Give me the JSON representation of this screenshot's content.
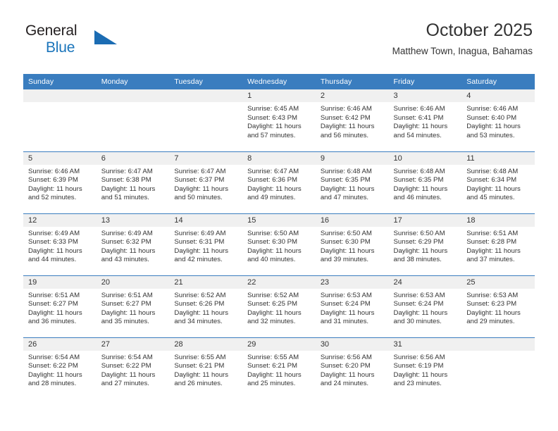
{
  "brand": {
    "name_part1": "General",
    "name_part2": "Blue",
    "accent_color": "#1b6cb3"
  },
  "header": {
    "title": "October 2025",
    "subtitle": "Matthew Town, Inagua, Bahamas"
  },
  "calendar": {
    "header_bg": "#3a7dbf",
    "daynum_bg": "#f0f0f0",
    "columns": [
      "Sunday",
      "Monday",
      "Tuesday",
      "Wednesday",
      "Thursday",
      "Friday",
      "Saturday"
    ],
    "weeks": [
      [
        {
          "day": "",
          "sunrise": "",
          "sunset": "",
          "daylight": "",
          "blank": true
        },
        {
          "day": "",
          "sunrise": "",
          "sunset": "",
          "daylight": "",
          "blank": true
        },
        {
          "day": "",
          "sunrise": "",
          "sunset": "",
          "daylight": "",
          "blank": true
        },
        {
          "day": "1",
          "sunrise": "Sunrise: 6:45 AM",
          "sunset": "Sunset: 6:43 PM",
          "daylight": "Daylight: 11 hours and 57 minutes."
        },
        {
          "day": "2",
          "sunrise": "Sunrise: 6:46 AM",
          "sunset": "Sunset: 6:42 PM",
          "daylight": "Daylight: 11 hours and 56 minutes."
        },
        {
          "day": "3",
          "sunrise": "Sunrise: 6:46 AM",
          "sunset": "Sunset: 6:41 PM",
          "daylight": "Daylight: 11 hours and 54 minutes."
        },
        {
          "day": "4",
          "sunrise": "Sunrise: 6:46 AM",
          "sunset": "Sunset: 6:40 PM",
          "daylight": "Daylight: 11 hours and 53 minutes."
        }
      ],
      [
        {
          "day": "5",
          "sunrise": "Sunrise: 6:46 AM",
          "sunset": "Sunset: 6:39 PM",
          "daylight": "Daylight: 11 hours and 52 minutes."
        },
        {
          "day": "6",
          "sunrise": "Sunrise: 6:47 AM",
          "sunset": "Sunset: 6:38 PM",
          "daylight": "Daylight: 11 hours and 51 minutes."
        },
        {
          "day": "7",
          "sunrise": "Sunrise: 6:47 AM",
          "sunset": "Sunset: 6:37 PM",
          "daylight": "Daylight: 11 hours and 50 minutes."
        },
        {
          "day": "8",
          "sunrise": "Sunrise: 6:47 AM",
          "sunset": "Sunset: 6:36 PM",
          "daylight": "Daylight: 11 hours and 49 minutes."
        },
        {
          "day": "9",
          "sunrise": "Sunrise: 6:48 AM",
          "sunset": "Sunset: 6:35 PM",
          "daylight": "Daylight: 11 hours and 47 minutes."
        },
        {
          "day": "10",
          "sunrise": "Sunrise: 6:48 AM",
          "sunset": "Sunset: 6:35 PM",
          "daylight": "Daylight: 11 hours and 46 minutes."
        },
        {
          "day": "11",
          "sunrise": "Sunrise: 6:48 AM",
          "sunset": "Sunset: 6:34 PM",
          "daylight": "Daylight: 11 hours and 45 minutes."
        }
      ],
      [
        {
          "day": "12",
          "sunrise": "Sunrise: 6:49 AM",
          "sunset": "Sunset: 6:33 PM",
          "daylight": "Daylight: 11 hours and 44 minutes."
        },
        {
          "day": "13",
          "sunrise": "Sunrise: 6:49 AM",
          "sunset": "Sunset: 6:32 PM",
          "daylight": "Daylight: 11 hours and 43 minutes."
        },
        {
          "day": "14",
          "sunrise": "Sunrise: 6:49 AM",
          "sunset": "Sunset: 6:31 PM",
          "daylight": "Daylight: 11 hours and 42 minutes."
        },
        {
          "day": "15",
          "sunrise": "Sunrise: 6:50 AM",
          "sunset": "Sunset: 6:30 PM",
          "daylight": "Daylight: 11 hours and 40 minutes."
        },
        {
          "day": "16",
          "sunrise": "Sunrise: 6:50 AM",
          "sunset": "Sunset: 6:30 PM",
          "daylight": "Daylight: 11 hours and 39 minutes."
        },
        {
          "day": "17",
          "sunrise": "Sunrise: 6:50 AM",
          "sunset": "Sunset: 6:29 PM",
          "daylight": "Daylight: 11 hours and 38 minutes."
        },
        {
          "day": "18",
          "sunrise": "Sunrise: 6:51 AM",
          "sunset": "Sunset: 6:28 PM",
          "daylight": "Daylight: 11 hours and 37 minutes."
        }
      ],
      [
        {
          "day": "19",
          "sunrise": "Sunrise: 6:51 AM",
          "sunset": "Sunset: 6:27 PM",
          "daylight": "Daylight: 11 hours and 36 minutes."
        },
        {
          "day": "20",
          "sunrise": "Sunrise: 6:51 AM",
          "sunset": "Sunset: 6:27 PM",
          "daylight": "Daylight: 11 hours and 35 minutes."
        },
        {
          "day": "21",
          "sunrise": "Sunrise: 6:52 AM",
          "sunset": "Sunset: 6:26 PM",
          "daylight": "Daylight: 11 hours and 34 minutes."
        },
        {
          "day": "22",
          "sunrise": "Sunrise: 6:52 AM",
          "sunset": "Sunset: 6:25 PM",
          "daylight": "Daylight: 11 hours and 32 minutes."
        },
        {
          "day": "23",
          "sunrise": "Sunrise: 6:53 AM",
          "sunset": "Sunset: 6:24 PM",
          "daylight": "Daylight: 11 hours and 31 minutes."
        },
        {
          "day": "24",
          "sunrise": "Sunrise: 6:53 AM",
          "sunset": "Sunset: 6:24 PM",
          "daylight": "Daylight: 11 hours and 30 minutes."
        },
        {
          "day": "25",
          "sunrise": "Sunrise: 6:53 AM",
          "sunset": "Sunset: 6:23 PM",
          "daylight": "Daylight: 11 hours and 29 minutes."
        }
      ],
      [
        {
          "day": "26",
          "sunrise": "Sunrise: 6:54 AM",
          "sunset": "Sunset: 6:22 PM",
          "daylight": "Daylight: 11 hours and 28 minutes."
        },
        {
          "day": "27",
          "sunrise": "Sunrise: 6:54 AM",
          "sunset": "Sunset: 6:22 PM",
          "daylight": "Daylight: 11 hours and 27 minutes."
        },
        {
          "day": "28",
          "sunrise": "Sunrise: 6:55 AM",
          "sunset": "Sunset: 6:21 PM",
          "daylight": "Daylight: 11 hours and 26 minutes."
        },
        {
          "day": "29",
          "sunrise": "Sunrise: 6:55 AM",
          "sunset": "Sunset: 6:21 PM",
          "daylight": "Daylight: 11 hours and 25 minutes."
        },
        {
          "day": "30",
          "sunrise": "Sunrise: 6:56 AM",
          "sunset": "Sunset: 6:20 PM",
          "daylight": "Daylight: 11 hours and 24 minutes."
        },
        {
          "day": "31",
          "sunrise": "Sunrise: 6:56 AM",
          "sunset": "Sunset: 6:19 PM",
          "daylight": "Daylight: 11 hours and 23 minutes."
        },
        {
          "day": "",
          "sunrise": "",
          "sunset": "",
          "daylight": "",
          "blank": true
        }
      ]
    ]
  }
}
